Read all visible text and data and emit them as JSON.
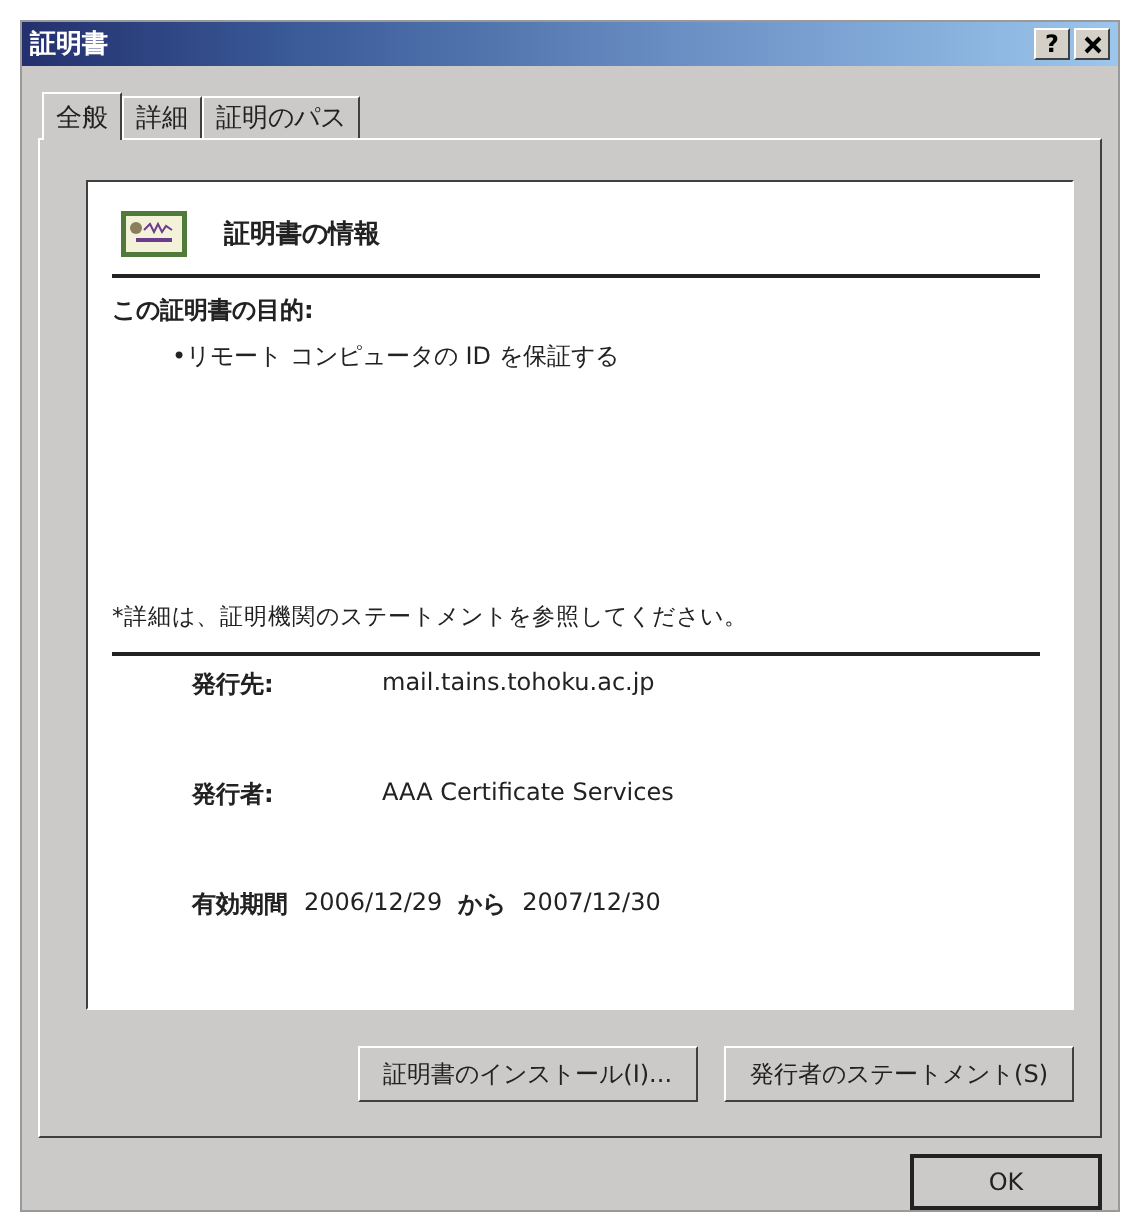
{
  "window": {
    "title": "証明書",
    "help_button": "?"
  },
  "tabs": [
    {
      "label": "全般",
      "selected": true
    },
    {
      "label": "詳細",
      "selected": false
    },
    {
      "label": "証明のパス",
      "selected": false
    }
  ],
  "info": {
    "heading": "証明書の情報",
    "purpose_heading": "この証明書の目的:",
    "purposes": [
      "•リモート コンピュータの ID を保証する"
    ],
    "note": "*詳細は、証明機関のステートメントを参照してください。",
    "fields": [
      {
        "label": "発行先:",
        "value": "mail.tains.tohoku.ac.jp"
      },
      {
        "label": "発行者:",
        "value": "AAA Certificate Services"
      }
    ],
    "validity": {
      "label": "有効期間",
      "from": "2006/12/29",
      "connector": "から",
      "to": "2007/12/30"
    }
  },
  "buttons": [
    "証明書のインストール(I)...",
    "発行者のステートメント(S)"
  ],
  "ok_button": "OK"
}
